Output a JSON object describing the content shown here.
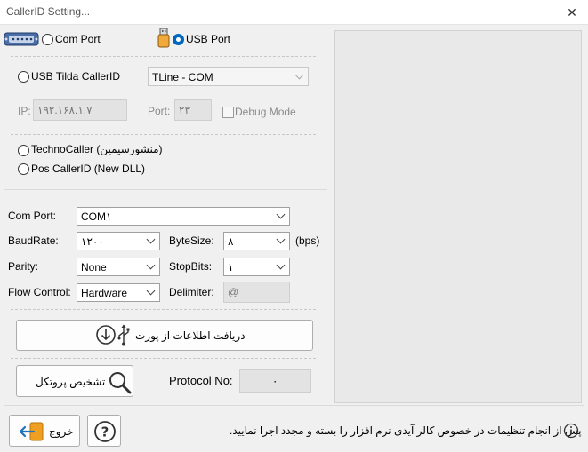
{
  "window": {
    "title": "CallerID Setting...",
    "close_glyph": "✕"
  },
  "ports": {
    "com_label": "Com Port",
    "usb_label": "USB Port",
    "selected": "usb"
  },
  "usb_tilda": {
    "label": "USB Tilda CallerID",
    "device": "TLine - COM",
    "ip_label": "IP:",
    "ip_value": "۱۹۲.۱۶۸.۱.۷",
    "port_label": "Port:",
    "port_value": "۲۳",
    "debug_label": "Debug Mode"
  },
  "techno": {
    "label": "TechnoCaller (منشورسیمین)"
  },
  "pos": {
    "label": "Pos CallerID (New DLL)"
  },
  "serial": {
    "com_port_label": "Com Port:",
    "com_port_value": "COM۱",
    "baud_label": "BaudRate:",
    "baud_value": "۱۲۰۰",
    "bytesize_label": "ByteSize:",
    "bytesize_value": "۸",
    "bps_label": "(bps)",
    "parity_label": "Parity:",
    "parity_value": "None",
    "stopbits_label": "StopBits:",
    "stopbits_value": "۱",
    "flow_label": "Flow Control:",
    "flow_value": "Hardware",
    "delimiter_label": "Delimiter:",
    "delimiter_value": "@"
  },
  "actions": {
    "receive_label": "دریافت اطلاعات از پورت",
    "detect_label": "تشخیص پروتکل",
    "protocol_label": "Protocol No:",
    "protocol_value": "۰"
  },
  "footer": {
    "exit_label": "خروج",
    "note": "پس از انجام تنظیمات در خصوص کالر آیدی نرم افزار را بسته و مجدد اجرا نمایید."
  },
  "colors": {
    "accent": "#0067c0",
    "exit_arrow": "#1e73b8",
    "exit_door": "#f0a020"
  }
}
